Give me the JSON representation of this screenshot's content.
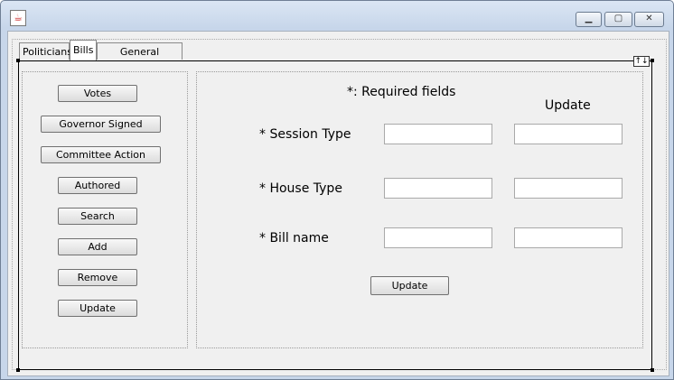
{
  "window": {
    "title": ""
  },
  "tabs": [
    {
      "label": "Politicians"
    },
    {
      "label": "Bills"
    },
    {
      "label": "General Assembly"
    }
  ],
  "left_buttons": [
    {
      "label": "Votes"
    },
    {
      "label": "Governor Signed"
    },
    {
      "label": "Committee Action"
    },
    {
      "label": "Authored"
    },
    {
      "label": "Search"
    },
    {
      "label": "Add"
    },
    {
      "label": "Remove"
    },
    {
      "label": "Update"
    }
  ],
  "form": {
    "required_note": "*: Required fields",
    "update_column_header": "Update",
    "fields": [
      {
        "label": "* Session Type",
        "value": "",
        "update_value": ""
      },
      {
        "label": "* House Type",
        "value": "",
        "update_value": ""
      },
      {
        "label": "* Bill name",
        "value": "",
        "update_value": ""
      }
    ],
    "update_button": "Update"
  },
  "icons": {
    "app": "java-icon",
    "minimize": "minimize-icon",
    "maximize": "maximize-icon",
    "close": "close-icon",
    "resize": "sort-arrows-icon"
  }
}
